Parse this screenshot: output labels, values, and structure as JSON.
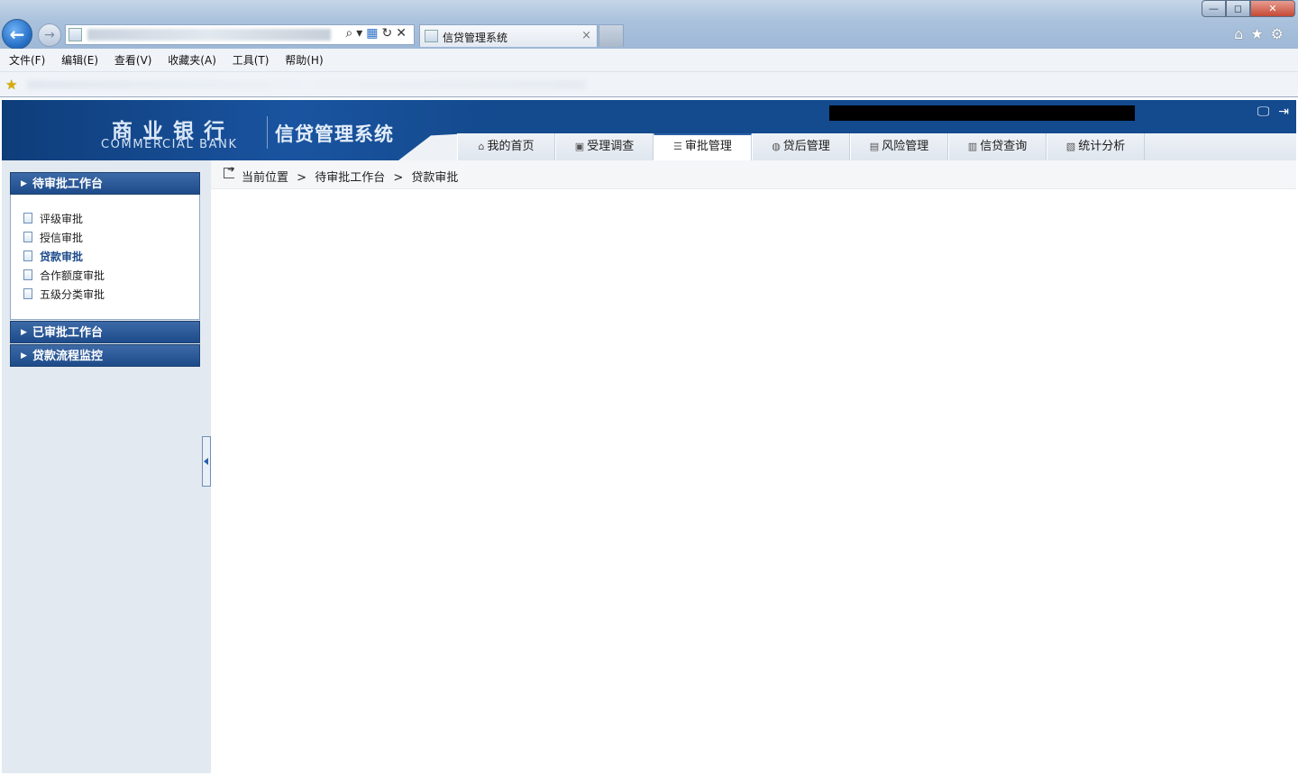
{
  "browser": {
    "tab_title": "信贷管理系统",
    "tab_close": "×",
    "window_controls": {
      "minimize": "—",
      "maximize": "◻",
      "close": "✕"
    },
    "nav_icons": {
      "back": "back-arrow-icon",
      "forward": "forward-arrow-icon"
    },
    "address_tools": [
      "search-icon",
      "compat-view-icon",
      "refresh-icon",
      "stop-icon"
    ],
    "chrome_icons": [
      "home-icon",
      "favorites-star-icon",
      "gear-icon"
    ],
    "menu": [
      "文件(F)",
      "编辑(E)",
      "查看(V)",
      "收藏夹(A)",
      "工具(T)",
      "帮助(H)"
    ]
  },
  "header": {
    "logo_cn": "商业银行",
    "logo_en": "COMMERCIAL BANK",
    "system_title": "信贷管理系统",
    "icons": [
      "monitor-icon",
      "logout-icon"
    ],
    "nav": [
      {
        "label": "我的首页",
        "icon": "home-icon",
        "active": false
      },
      {
        "label": "受理调查",
        "icon": "survey-icon",
        "active": false
      },
      {
        "label": "审批管理",
        "icon": "list-icon",
        "active": true
      },
      {
        "label": "贷后管理",
        "icon": "postloan-icon",
        "active": false
      },
      {
        "label": "风险管理",
        "icon": "risk-icon",
        "active": false
      },
      {
        "label": "信贷查询",
        "icon": "query-icon",
        "active": false
      },
      {
        "label": "统计分析",
        "icon": "stats-icon",
        "active": false
      }
    ]
  },
  "sidebar": {
    "panels": [
      {
        "title": "待审批工作台",
        "expanded": true,
        "items": [
          "评级审批",
          "授信审批",
          "贷款审批",
          "合作额度审批",
          "五级分类审批"
        ],
        "active_item": "贷款审批"
      },
      {
        "title": "已审批工作台",
        "expanded": false
      },
      {
        "title": "贷款流程监控",
        "expanded": false
      }
    ]
  },
  "breadcrumb": {
    "label": "当前位置",
    "separator": ">",
    "path": [
      "待审批工作台",
      "贷款审批"
    ]
  },
  "colors": {
    "header_blue": "#144a8e",
    "sidebar_bg": "#e3e9f0",
    "panel_head": "#2a5fa8"
  }
}
